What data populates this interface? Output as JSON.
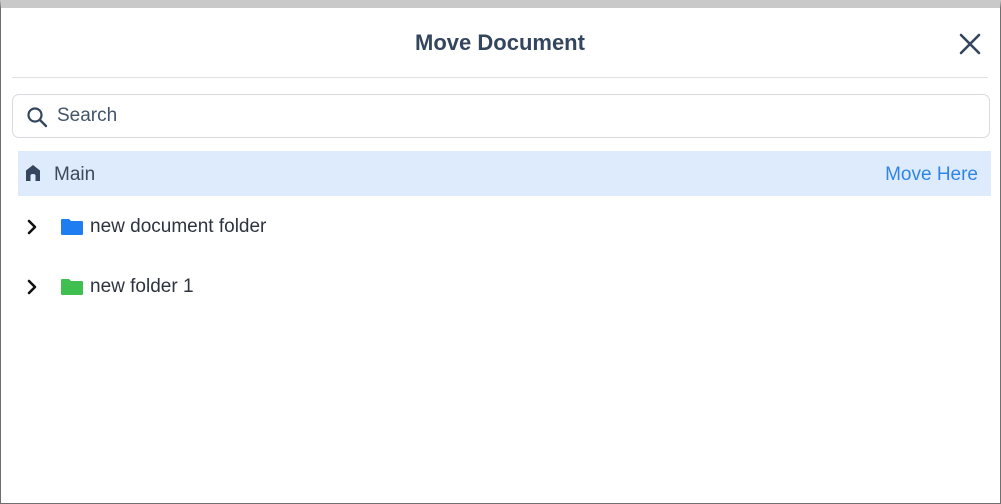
{
  "dialog": {
    "title": "Move Document",
    "close_icon": "close-icon"
  },
  "search": {
    "placeholder": "Search",
    "value": "",
    "icon": "search-icon"
  },
  "tree": {
    "root": {
      "label": "Main",
      "icon": "home-icon",
      "action_label": "Move Here",
      "selected": true,
      "highlight_color": "#deebfc",
      "action_color": "#2f86e8"
    },
    "folders": [
      {
        "label": "new document folder",
        "icon": "folder-icon",
        "color": "#1f7df2",
        "expanded": false
      },
      {
        "label": "new folder 1",
        "icon": "folder-icon",
        "color": "#3fbf4f",
        "expanded": false
      }
    ]
  }
}
